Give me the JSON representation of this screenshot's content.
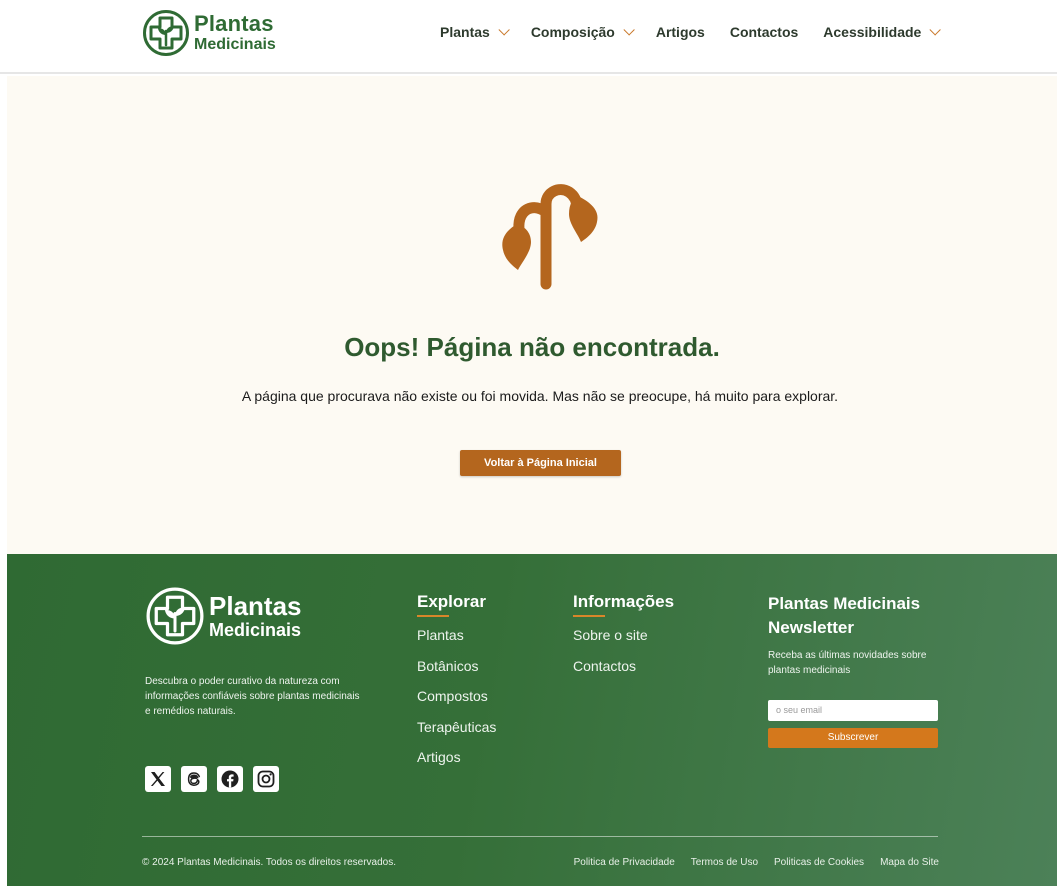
{
  "header": {
    "logo": {
      "line1": "Plantas",
      "line2": "Medicinais"
    },
    "nav": [
      {
        "label": "Plantas",
        "has_dropdown": true
      },
      {
        "label": "Composição",
        "has_dropdown": true
      },
      {
        "label": "Artigos",
        "has_dropdown": false
      },
      {
        "label": "Contactos",
        "has_dropdown": false
      },
      {
        "label": "Acessibilidade",
        "has_dropdown": true
      }
    ]
  },
  "main": {
    "icon": "sprout-icon",
    "title": "Oops! Página não encontrada.",
    "message": "A página que procurava não existe ou foi movida. Mas não se preocupe, há muito para explorar.",
    "button_label": "Voltar à Página Inicial"
  },
  "footer": {
    "logo": {
      "line1": "Plantas",
      "line2": "Medicinais"
    },
    "description": "Descubra o poder curativo da natureza com informações confiáveis sobre plantas medicinais e remédios naturais.",
    "socials": [
      "x-icon",
      "threads-icon",
      "facebook-icon",
      "instagram-icon"
    ],
    "explore": {
      "heading": "Explorar",
      "links": [
        "Plantas",
        "Botânicos",
        "Compostos",
        "Terapêuticas",
        "Artigos"
      ]
    },
    "info": {
      "heading": "Informações",
      "links": [
        "Sobre o site",
        "Contactos"
      ]
    },
    "newsletter": {
      "heading": "Plantas Medicinais Newsletter",
      "text": "Receba as últimas novidades sobre plantas medicinais",
      "email_placeholder": "o seu email",
      "subscribe_label": "Subscrever"
    },
    "copyright": "© 2024 Plantas Medicinais. Todos os direitos reservados.",
    "legal_links": [
      "Politica de Privacidade",
      "Termos de Uso",
      "Politicas de Cookies",
      "Mapa do Site"
    ]
  },
  "colors": {
    "brand_green": "#2f6b34",
    "accent_orange": "#b4661e",
    "page_background": "#fdfaf3",
    "footer_green": "#356f38"
  }
}
